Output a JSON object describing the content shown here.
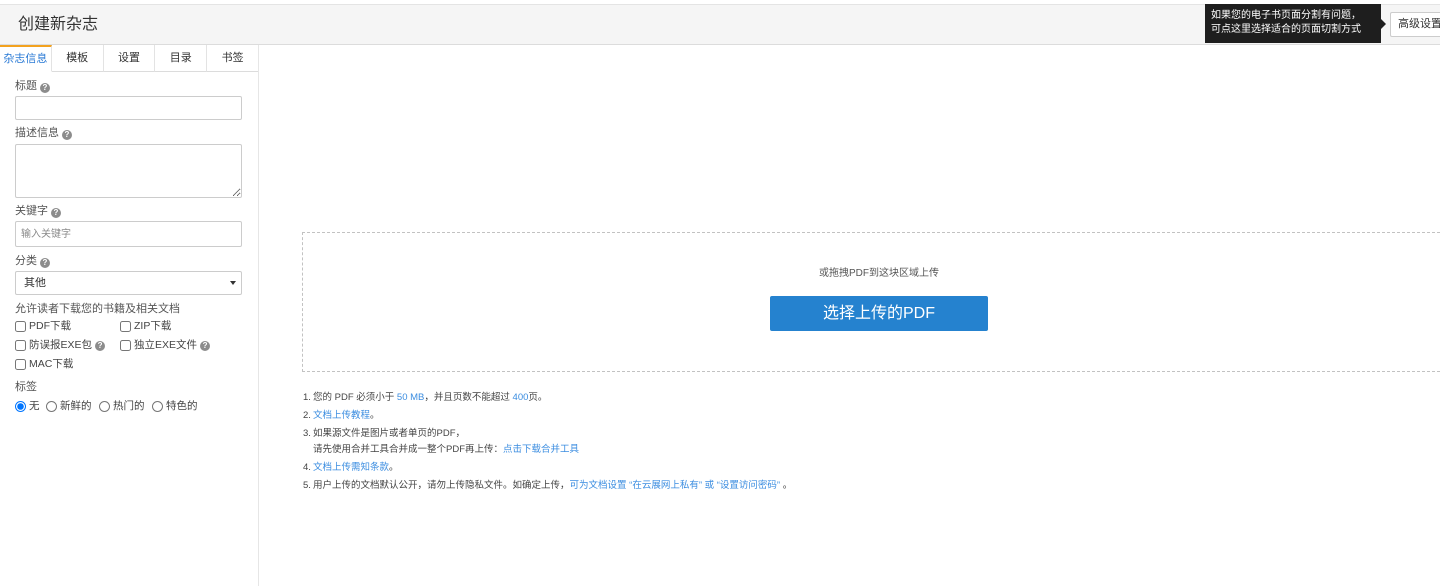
{
  "colors": {
    "accent": "#2582cf",
    "link": "#3b8de0",
    "tab_active": "#2a7ad5",
    "tab_active_border": "#f3a21f",
    "tooltip_bg": "#1e1e1e"
  },
  "icons": {
    "help": "help-icon",
    "select_arrow": "chevron-down-icon"
  },
  "header": {
    "title": "创建新杂志",
    "advanced_button": "高级设置"
  },
  "tooltip": {
    "line1": "如果您的电子书页面分割有问题，",
    "line2": "可点这里选择适合的页面切割方式"
  },
  "sidebar": {
    "tabs": [
      {
        "label": "杂志信息",
        "active": true
      },
      {
        "label": "模板",
        "active": false
      },
      {
        "label": "设置",
        "active": false
      },
      {
        "label": "目录",
        "active": false
      },
      {
        "label": "书签",
        "active": false
      }
    ],
    "form": {
      "title_label": "标题",
      "description_label": "描述信息",
      "keywords_label": "关键字",
      "keywords_placeholder": "输入关键字",
      "category_label": "分类",
      "category_selected": "其他",
      "download_label": "允许读者下载您的书籍及相关文档",
      "download_options": [
        {
          "label": "PDF下载",
          "checked": false
        },
        {
          "label": "ZIP下载",
          "checked": false
        },
        {
          "label": "防误报EXE包",
          "checked": false
        },
        {
          "label": "独立EXE文件",
          "checked": false
        },
        {
          "label": "MAC下载",
          "checked": false
        }
      ],
      "tags_label": "标签",
      "tag_options": [
        {
          "label": "无",
          "checked": true
        },
        {
          "label": "新鲜的",
          "checked": false
        },
        {
          "label": "热门的",
          "checked": false
        },
        {
          "label": "特色的",
          "checked": false
        }
      ]
    }
  },
  "upload": {
    "drop_hint": "或拖拽PDF到这块区域上传",
    "select_button": "选择上传的PDF"
  },
  "notes": [
    {
      "num": "1.",
      "text_before": "您的 PDF 必须小于 ",
      "size_limit": "50 MB",
      "text_middle": "，并且页数不能超过 ",
      "page_limit": "400",
      "text_after": "页。"
    },
    {
      "num": "2.",
      "link": "文档上传教程",
      "text_after": "。"
    },
    {
      "num": "3.",
      "line1": "如果源文件是图片或者单页的PDF，",
      "line2": "请先使用合并工具合并成一整个PDF再上传：",
      "link": "点击下载合并工具"
    },
    {
      "num": "4.",
      "link": "文档上传需知条款",
      "text_after": "。"
    },
    {
      "num": "5.",
      "text": "用户上传的文档默认公开，请勿上传隐私文件。如确定上传，",
      "link": "可为文档设置 “在云展网上私有” 或 “设置访问密码”",
      "text_after": " 。"
    }
  ]
}
